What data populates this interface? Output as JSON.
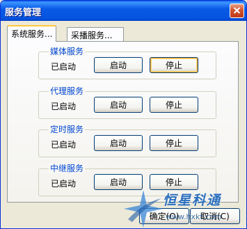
{
  "window": {
    "title": "服务管理"
  },
  "tabs": [
    {
      "label": "系统服务..."
    },
    {
      "label": "采播服务..."
    }
  ],
  "groups": [
    {
      "title": "媒体服务",
      "status": "已启动",
      "start_label": "启动",
      "stop_label": "停止"
    },
    {
      "title": "代理服务",
      "status": "已启动",
      "start_label": "启动",
      "stop_label": "停止"
    },
    {
      "title": "定时服务",
      "status": "已启动",
      "start_label": "启动",
      "stop_label": "停止"
    },
    {
      "title": "中继服务",
      "status": "已启动",
      "start_label": "启动",
      "stop_label": "停止"
    }
  ],
  "footer": {
    "ok_label": "确定(O)",
    "cancel_label": "取消(C)"
  },
  "watermark": {
    "text": "恒星科通",
    "url": "www.hxkt.com"
  },
  "colors": {
    "titlebar": "#0a5ae6",
    "group_title": "#0046d5",
    "tab_highlight": "#ffc83c"
  }
}
